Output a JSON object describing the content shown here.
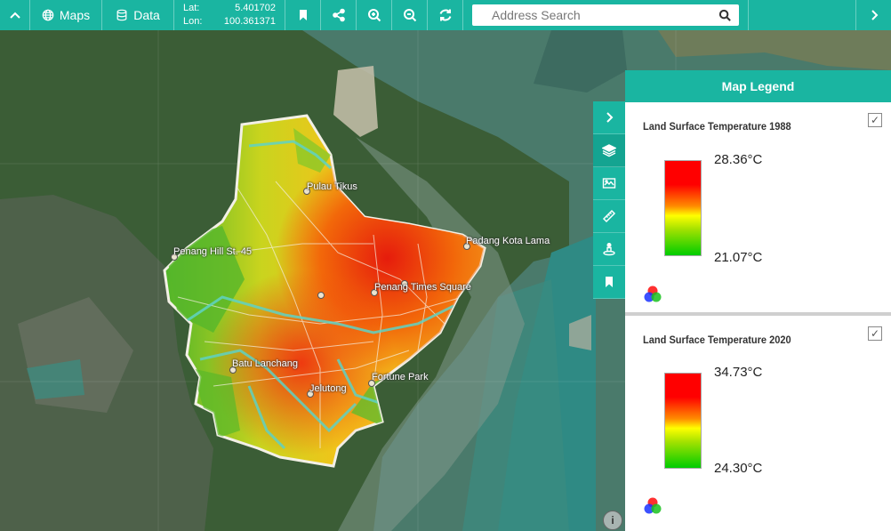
{
  "toolbar": {
    "maps_label": "Maps",
    "data_label": "Data",
    "lat_label": "Lat:",
    "lat_value": "5.401702",
    "lon_label": "Lon:",
    "lon_value": "100.361371",
    "search_placeholder": "Address Search",
    "icons": [
      "chevron-up-icon",
      "globe-icon",
      "database-icon",
      "bookmark-icon",
      "share-icon",
      "zoom-in-icon",
      "zoom-out-icon",
      "refresh-icon",
      "search-icon",
      "chevron-right-icon"
    ]
  },
  "map": {
    "places": [
      {
        "name": "Pulau Tikus"
      },
      {
        "name": "Padang Kota Lama"
      },
      {
        "name": "Penang Hill St. 45"
      },
      {
        "name": "Penang Times Square"
      },
      {
        "name": "Batu Lanchang"
      },
      {
        "name": "Fortune Park"
      },
      {
        "name": "Jelutong"
      }
    ],
    "info_label": "i"
  },
  "side_tools": [
    "chevron-right-icon",
    "layers-icon",
    "map-card-icon",
    "ruler-icon",
    "person-pin-icon",
    "bookmark-icon"
  ],
  "legend": {
    "title": "Map Legend",
    "layers": [
      {
        "title": "Land Surface Temperature 1988",
        "max": "28.36°C",
        "min": "21.07°C",
        "checked": "✓"
      },
      {
        "title": "Land Surface Temperature 2020",
        "max": "34.73°C",
        "min": "24.30°C",
        "checked": "✓"
      }
    ]
  },
  "colors": {
    "accent": "#1ab5a1",
    "ramp_high": "#ff0000",
    "ramp_mid": "#ffff00",
    "ramp_low": "#00cc00",
    "sea": "#3f6e62",
    "land": "#3a5a32"
  }
}
